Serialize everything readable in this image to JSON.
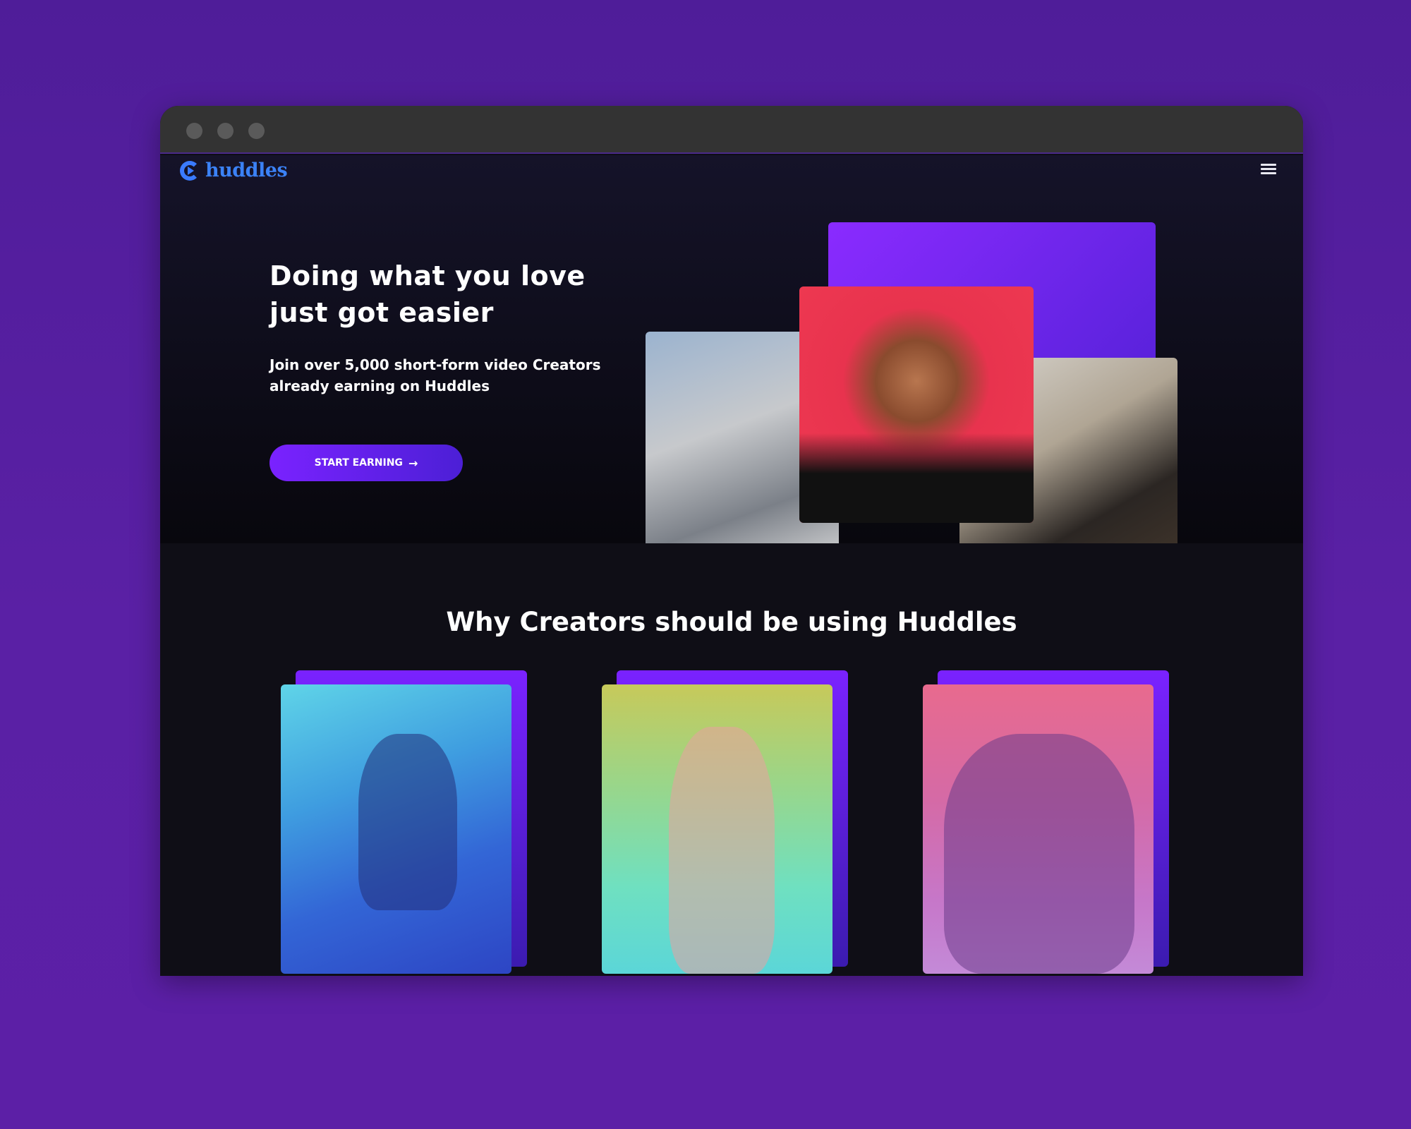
{
  "brand": {
    "name": "huddles"
  },
  "hero": {
    "headline": "Doing what you love just got easier",
    "subcopy": "Join over 5,000 short-form video Creators already earning on Huddles",
    "cta_label": "START EARNING",
    "cta_icon": "arrow-right-icon"
  },
  "features": {
    "title": "Why Creators should be using Huddles"
  },
  "colors": {
    "page_background": "#5a20a5",
    "site_background": "#0e0d16",
    "accent": "#7a22ff",
    "logo": "#3b82f6"
  }
}
